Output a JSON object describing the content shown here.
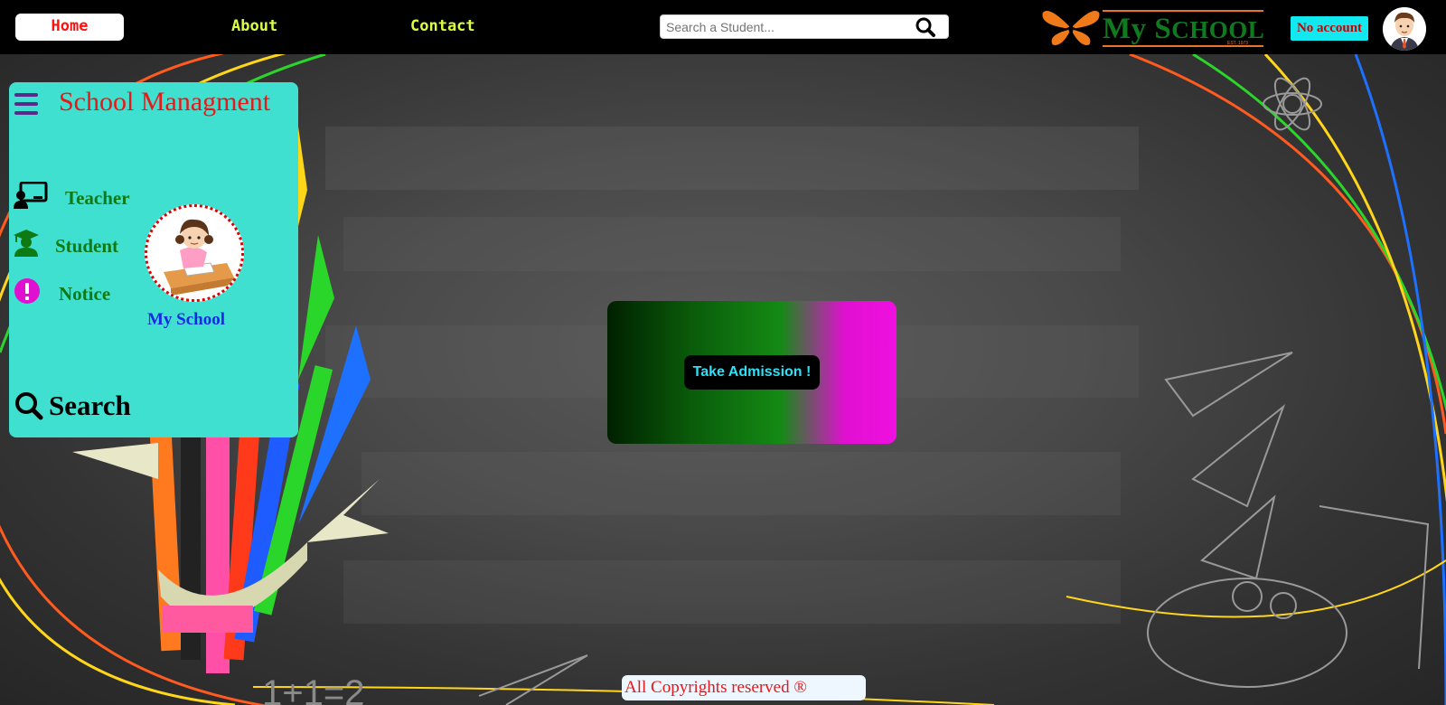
{
  "nav": {
    "home": "Home",
    "about": "About",
    "contact": "Contact",
    "search_placeholder": "Search a Student...",
    "logo_text_big": "My S",
    "logo_text_small": "CHOOL",
    "logo_est": "EST. 1973",
    "no_account": "No account"
  },
  "sidebar": {
    "title": "School Managment",
    "items": [
      {
        "label": "Teacher",
        "icon": "teacher-icon"
      },
      {
        "label": "Student",
        "icon": "student-icon"
      },
      {
        "label": "Notice",
        "icon": "notice-icon"
      }
    ],
    "profile_name": "My School",
    "search_label": "Search"
  },
  "main": {
    "admission_button": "Take Admission !"
  },
  "footer": {
    "text": "All Copyrights reserved ®"
  },
  "colors": {
    "sidebar_bg": "#40e0d0",
    "title_red": "#e81818",
    "item_green": "#0e7a14",
    "nav_link": "#d9ff40",
    "no_account_bg": "#11e8f0",
    "admit_text": "#2de0f8"
  }
}
